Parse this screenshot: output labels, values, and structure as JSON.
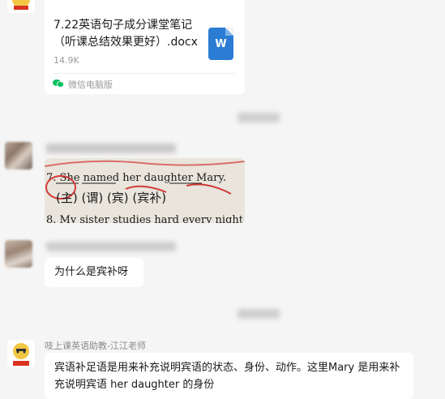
{
  "file_message": {
    "file_name": "7.22英语句子成分课堂笔记（听课总结效果更好）.docx",
    "file_size": "14.9K",
    "source_label": "微信电脑版",
    "file_type_letter": "W"
  },
  "image_message": {
    "ocr_line_1": "7. She named her daughter Mary.",
    "ocr_line_2": "(主) (谓) (宾) (宾补)",
    "ocr_line_3": "8. My sister studies hard every night"
  },
  "question_message": {
    "text": "为什么是宾补呀"
  },
  "answer_message": {
    "sender": "吱上课英语助教-江江老师",
    "text": "宾语补足语是用来补充说明宾语的状态、身份、动作。这里Mary 是用来补充说明宾语 her daughter 的身份"
  },
  "colors": {
    "background": "#f5f5f5",
    "bubble": "#ffffff",
    "word_blue": "#2b7cd3",
    "wechat_green": "#07c160",
    "secondary_text": "#9a9a9a"
  }
}
